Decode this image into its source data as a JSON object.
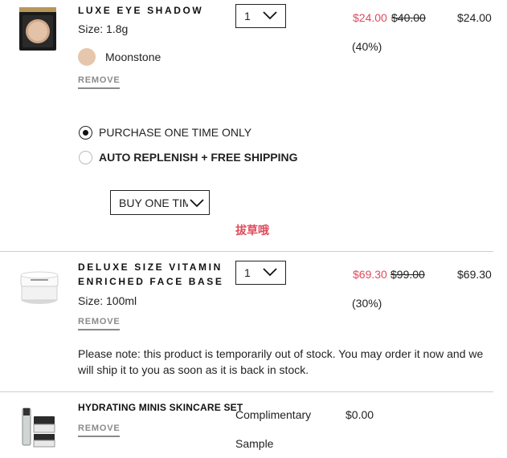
{
  "items": [
    {
      "name": "LUXE EYE SHADOW",
      "size": "Size: 1.8g",
      "shade": "Moonstone",
      "shade_color": "#e6c6ac",
      "remove": "REMOVE",
      "qty": "1",
      "sale_price": "$24.00",
      "old_price": "$40.00",
      "discount": "(40%)",
      "total": "$24.00"
    },
    {
      "name_line1": "DELUXE SIZE VITAMIN",
      "name_line2": "ENRICHED FACE BASE",
      "size": "Size: 100ml",
      "remove": "REMOVE",
      "qty": "1",
      "sale_price": "$69.30",
      "old_price": "$99.00",
      "discount": "(30%)",
      "total": "$69.30",
      "note": "Please note: this product is temporarily out of stock. You may order it now and we will ship it to you as soon as it is back in stock."
    },
    {
      "name": "HYDRATING MINIS SKINCARE SET",
      "remove": "REMOVE",
      "status_line1": "Complimentary",
      "status_line2": "Sample",
      "price": "$0.00"
    }
  ],
  "purchase": {
    "one_time": "PURCHASE ONE TIME ONLY",
    "auto_replenish": "AUTO REPLENISH + FREE SHIPPING",
    "frequency_value": "BUY ONE TIME"
  },
  "watermark": "拔草哦",
  "colors": {
    "sale": "#e04a5c",
    "text": "#222222",
    "divider": "#cfcfcf"
  }
}
